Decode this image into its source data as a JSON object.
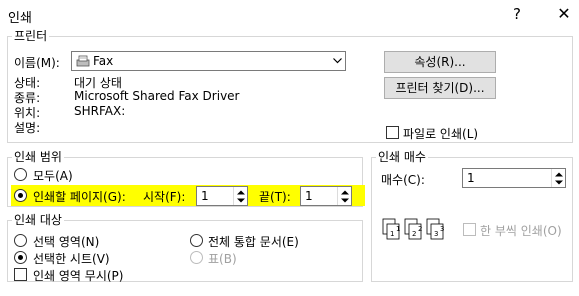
{
  "window": {
    "title": "인쇄",
    "help_glyph": "?",
    "close_glyph": "✕"
  },
  "printer": {
    "legend": "프린터",
    "name_label": "이름(M):",
    "name_value": "Fax",
    "status_label": "상태:",
    "status_value": "대기 상태",
    "type_label": "종류:",
    "type_value": "Microsoft Shared Fax Driver",
    "where_label": "위치:",
    "where_value": "SHRFAX:",
    "comment_label": "설명:",
    "properties_button": "속성(R)...",
    "find_printer_button": "프린터 찾기(D)...",
    "print_to_file_label": "파일로 인쇄(L)"
  },
  "print_range": {
    "legend": "인쇄 범위",
    "all_label": "모두(A)",
    "pages_label": "인쇄할 페이지(G):",
    "from_label": "시작(F):",
    "from_value": "1",
    "to_label": "끝(T):",
    "to_value": "1"
  },
  "print_what": {
    "legend": "인쇄 대상",
    "selection_label": "선택 영역(N)",
    "entire_workbook_label": "전체 통합 문서(E)",
    "active_sheets_label": "선택한 시트(V)",
    "table_label": "표(B)",
    "ignore_print_areas_label": "인쇄 영역 무시(P)"
  },
  "copies": {
    "legend": "인쇄 매수",
    "number_label": "매수(C):",
    "number_value": "1",
    "collate_label": "한 부씩 인쇄(O)"
  },
  "colors": {
    "highlight": "#ffff00",
    "disabled": "#a0a0a0"
  }
}
